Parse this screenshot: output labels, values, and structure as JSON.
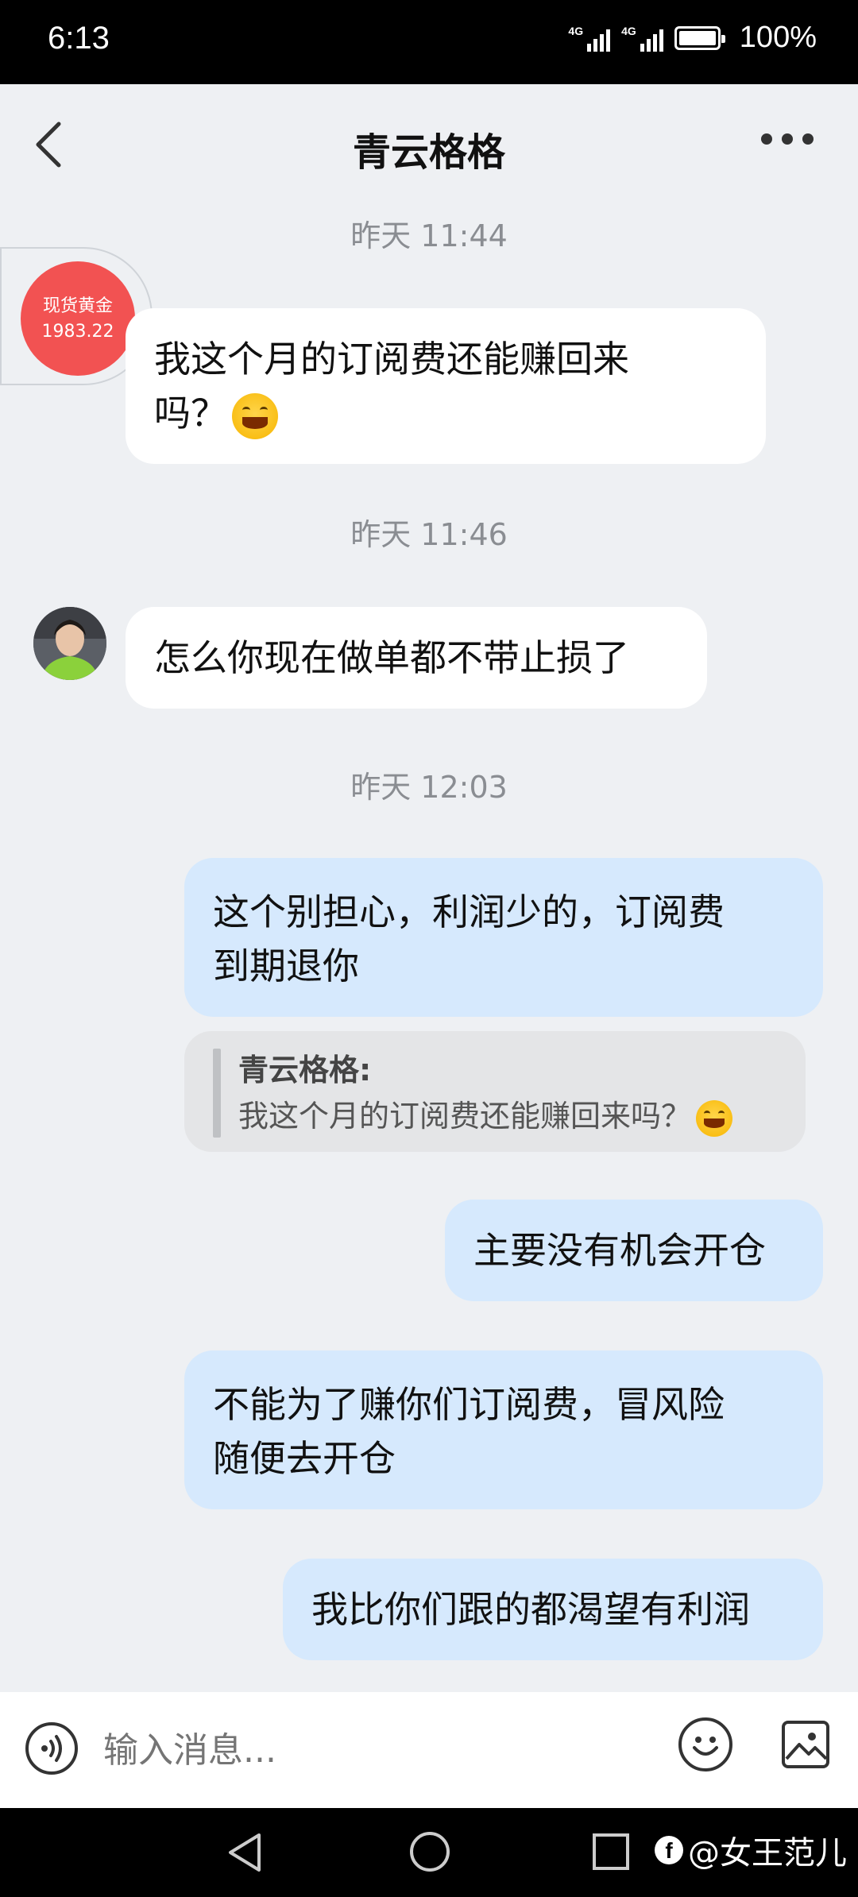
{
  "status_bar": {
    "time": "6:13",
    "network1": "4G",
    "network2": "4G",
    "battery": "100%"
  },
  "header": {
    "title": "青云格格"
  },
  "messages": {
    "ts1": "昨天 11:44",
    "m1": "我这个月的订阅费还能赚回来",
    "m1_tail": "吗？",
    "avatar_gold_line1": "现货黄金",
    "avatar_gold_line2": "1983.22",
    "ts2": "昨天 11:46",
    "m2": "怎么你现在做单都不带止损了",
    "ts3": "昨天 12:03",
    "m3_line1": "这个别担心，利润少的，订阅费",
    "m3_line2": "到期退你",
    "quote_name": "青云格格:",
    "quote_text": "我这个月的订阅费还能赚回来吗？",
    "m4": "主要没有机会开仓",
    "m5_line1": "不能为了赚你们订阅费，冒风险",
    "m5_line2": "随便去开仓",
    "m6": "我比你们跟的都渴望有利润"
  },
  "input": {
    "placeholder": "输入消息..."
  },
  "watermark": {
    "text": "@女王范儿"
  },
  "icons": {
    "back": "chevron-left-icon",
    "more": "more-dots-icon",
    "voice": "voice-icon",
    "emoji": "emoji-icon",
    "image": "image-icon",
    "smile": "grinning-face-icon"
  },
  "colors": {
    "incoming_bubble": "#ffffff",
    "outgoing_bubble": "#d6e9fd",
    "gold_avatar": "#f25252"
  }
}
